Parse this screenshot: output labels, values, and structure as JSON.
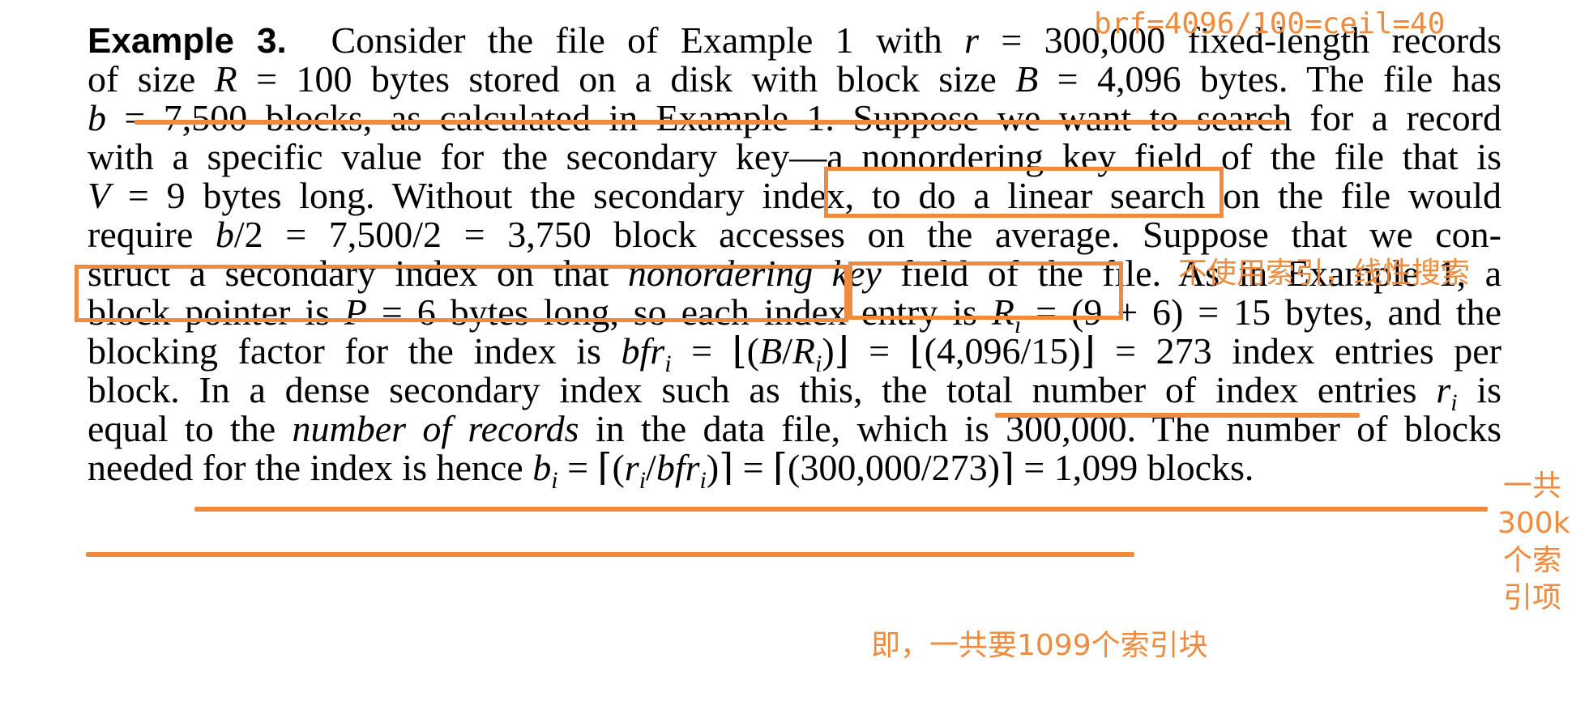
{
  "paragraph": {
    "lead": "Example 3.",
    "lines": [
      [
        "Consider the file of Example 1 with ",
        "r",
        " = 300,000 fixed-length records"
      ],
      [
        "of size ",
        "R",
        " = 100 bytes stored on a disk with block size ",
        "B",
        " = 4,096 bytes. The file has"
      ],
      [
        "b",
        " = 7,500 blocks, as calculated in Example 1. Suppose we want to search for a record"
      ],
      [
        "with a specific value for the secondary key—a nonordering key field of the file that is"
      ],
      [
        "V",
        " = 9 bytes long. Without the secondary index, to do a linear search on the file would"
      ],
      [
        "require ",
        "b",
        "/2 = 7,500/2 = 3,750 block accesses on the average. Suppose that we con-"
      ],
      [
        "struct a secondary index on that ",
        "nonordering key",
        " field of the file. As in Example 1, a"
      ],
      [
        "block pointer is ",
        "P",
        " = 6 bytes long, so each index entry is ",
        "R",
        "i",
        " = (9 + 6) = 15 bytes, and the"
      ],
      [
        "blocking factor for the index is ",
        "bfr",
        "i",
        " = ⌊(",
        "B",
        "/",
        "R",
        "i",
        ")⌋ = ⌊(4,096/15)⌋ = 273 index entries per"
      ],
      [
        "block. In a dense secondary index such as this, the total number of index entries ",
        "r",
        "i",
        " is"
      ],
      [
        "equal to the ",
        "number of records",
        " in the data file, which is 300,000. The number of blocks"
      ],
      [
        "needed for the index is hence ",
        "b",
        "i",
        " = ⌈(",
        "r",
        "i",
        "/",
        "bfr",
        "i",
        ")⌉ = ⌈(300,000/273)⌉ = 1,099 blocks."
      ]
    ]
  },
  "annotations": {
    "brf_note": "brf=4096/100=ceil=40",
    "linear_search_note": "不使用索引，线性搜索",
    "total_index_note": "一共300k个索引项",
    "index_blocks_note": "即，一共要1099个索引块",
    "color": "#f08a3c"
  }
}
